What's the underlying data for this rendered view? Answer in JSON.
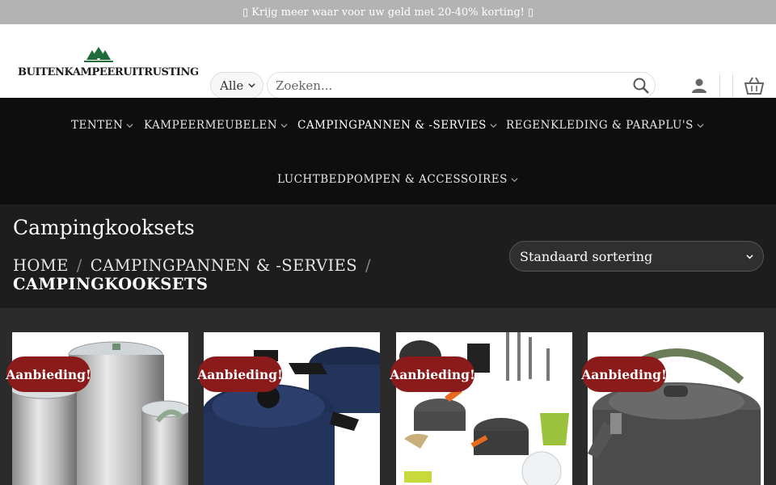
{
  "topbar": {
    "text": "▯ Krijg meer waar voor uw geld met 20-40% korting! ▯"
  },
  "logo": {
    "text": "BUITENKAMPEERUITRUSTING"
  },
  "search": {
    "category": "Alle",
    "placeholder": "Zoeken..."
  },
  "nav": {
    "items": [
      "TENTEN",
      "KAMPEERMEUBELEN",
      "CAMPINGPANNEN & -SERVIES",
      "REGENKLEDING & PARAPLU'S",
      "LUCHTBEDPOMPEN & ACCESSOIRES"
    ]
  },
  "page": {
    "title": "Campingkooksets",
    "breadcrumb": {
      "home": "HOME",
      "parent": "CAMPINGPANNEN & -SERVIES",
      "current": "CAMPINGKOOKSETS"
    },
    "sort_label": "Standaard sortering"
  },
  "products": [
    {
      "badge": "Aanbieding!",
      "image": "stainless-steel-pot-set"
    },
    {
      "badge": "Aanbieding!",
      "image": "blue-enamel-pots"
    },
    {
      "badge": "Aanbieding!",
      "image": "camping-cookware-kit"
    },
    {
      "badge": "Aanbieding!",
      "image": "aluminium-kettle"
    }
  ],
  "colors": {
    "badge": "#8b1a1a",
    "nav_bg": "#0e0e0e",
    "title_bg": "#1d1d1d",
    "topbar_bg": "#b3b3b3",
    "logo_green": "#1f6b3a"
  }
}
